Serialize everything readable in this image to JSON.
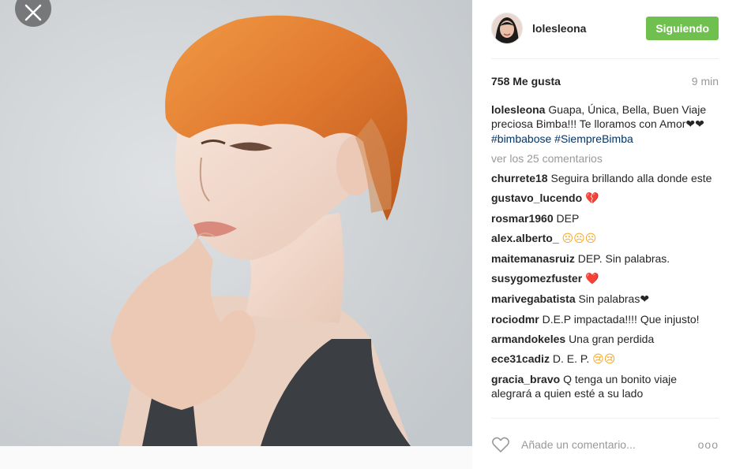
{
  "post": {
    "username": "lolesleona",
    "follow_label": "Siguiendo",
    "likes": "758 Me gusta",
    "time_ago": "9 min",
    "caption_user": "lolesleona",
    "caption_text": "Guapa, Única, Bella, Buen Viaje preciosa Bimba!!! Te lloramos con Amor",
    "caption_hearts": "❤❤",
    "hashtags": [
      "#bimbabose",
      "#SiempreBimba"
    ],
    "view_all_label": "ver los 25 comentarios",
    "add_comment_placeholder": "Añade un comentario...",
    "more_label": "ooo"
  },
  "comments": [
    {
      "user": "churrete18",
      "text": "Seguira brillando alla donde este",
      "emoji": ""
    },
    {
      "user": "gustavo_lucendo",
      "text": "",
      "emoji": "💔"
    },
    {
      "user": "rosmar1960",
      "text": "DEP",
      "emoji": ""
    },
    {
      "user": "alex.alberto_",
      "text": "",
      "emoji": "☹☹☹"
    },
    {
      "user": "maitemanasruiz",
      "text": "DEP. Sin palabras.",
      "emoji": ""
    },
    {
      "user": "susygomezfuster",
      "text": "",
      "emoji": "❤️"
    },
    {
      "user": "marivegabatista",
      "text": "Sin palabras",
      "emoji": "❤"
    },
    {
      "user": "rociodmr",
      "text": "D.E.P impactada!!!! Que injusto!",
      "emoji": ""
    },
    {
      "user": "armandokeles",
      "text": "Una gran perdida",
      "emoji": ""
    },
    {
      "user": "ece31cadiz",
      "text": "D. E. P.",
      "emoji": "😢😢"
    },
    {
      "user": "gracia_bravo",
      "text": "Q tenga un bonito viaje alegrará a quien esté a su lado",
      "emoji": ""
    }
  ],
  "colors": {
    "follow_button": "#70c050",
    "hashtag": "#003569",
    "hair": "#e0782e"
  }
}
